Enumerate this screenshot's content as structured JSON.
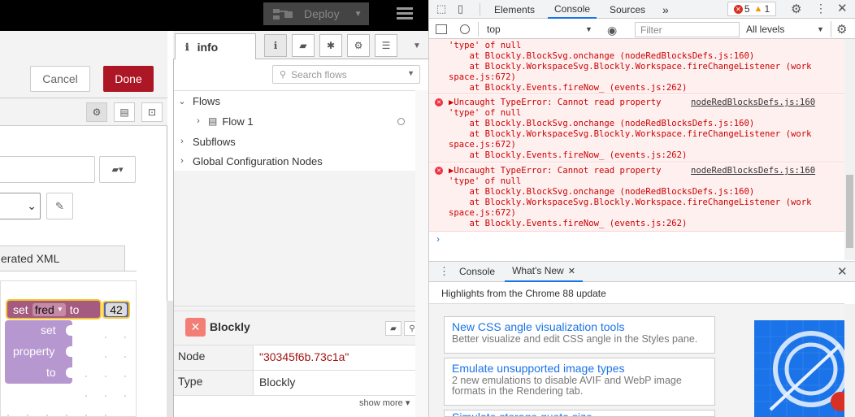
{
  "nodered": {
    "deploy_label": "Deploy",
    "tray": {
      "cancel_label": "Cancel",
      "done_label": "Done",
      "xml_tab_label": "erated XML"
    },
    "blockly": {
      "set_kw": "set",
      "var_name": "fred",
      "to_kw": "to",
      "number": "42",
      "obj_lines": [
        "set",
        "property",
        "to"
      ]
    },
    "sidebar": {
      "info_tab_label": "info",
      "search_placeholder": "Search flows",
      "tree": {
        "flows": "Flows",
        "flow1": "Flow 1",
        "subflows": "Subflows",
        "global_config": "Global Configuration Nodes"
      },
      "node": {
        "title": "Blockly",
        "props": [
          {
            "key": "Node",
            "value": "\"30345f6b.73c1a\""
          },
          {
            "key": "Type",
            "value": "Blockly"
          }
        ],
        "show_more": "show more ▾"
      }
    }
  },
  "devtools": {
    "tabs": [
      "Elements",
      "Console",
      "Sources",
      "»"
    ],
    "error_count": "5",
    "warning_count": "1",
    "context": "top",
    "filter_placeholder": "Filter",
    "levels_label": "All levels",
    "messages": {
      "partial": {
        "lines": [
          "'type' of null",
          "    at Blockly.BlockSvg.onchange (nodeRedBlocksDefs.js:160)",
          "    at Blockly.WorkspaceSvg.Blockly.Workspace.fireChangeListener (work",
          "space.js:672)",
          "    at Blockly.Events.fireNow_ (events.js:262)"
        ]
      },
      "full": {
        "head": "▶Uncaught TypeError: Cannot read property",
        "source": "nodeRedBlocksDefs.js:160",
        "lines": [
          "'type' of null",
          "    at Blockly.BlockSvg.onchange (nodeRedBlocksDefs.js:160)",
          "    at Blockly.WorkspaceSvg.Blockly.Workspace.fireChangeListener (work",
          "space.js:672)",
          "    at Blockly.Events.fireNow_ (events.js:262)"
        ]
      }
    },
    "prompt": "›",
    "drawer": {
      "console_tab": "Console",
      "whatsnew_tab": "What's New",
      "headline": "Highlights from the Chrome 88 update",
      "cards": [
        {
          "title": "New CSS angle visualization tools",
          "desc": "Better visualize and edit CSS angle in the Styles pane."
        },
        {
          "title": "Emulate unsupported image types",
          "desc": "2 new emulations to disable AVIF and WebP image formats in the Rendering tab."
        },
        {
          "title": "Simulate storage quota size",
          "desc": ""
        }
      ]
    }
  },
  "colors": {
    "done_red": "#ad1625",
    "node_red_icon": "#f27e75",
    "devtools_blue": "#1a73e8",
    "error_red": "#c00"
  }
}
